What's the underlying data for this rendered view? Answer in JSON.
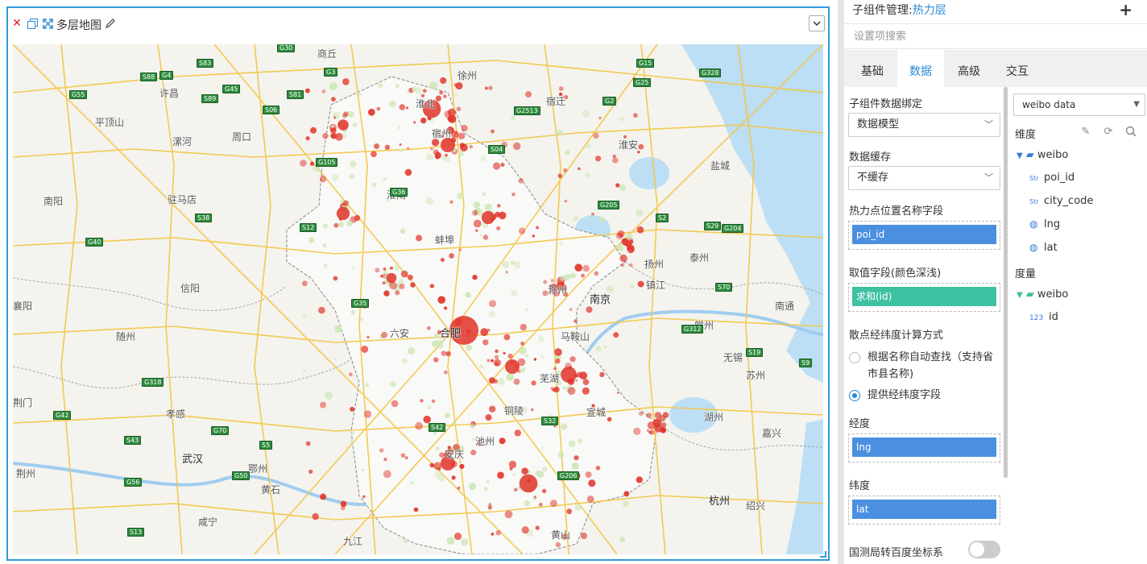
{
  "widget": {
    "title": "多层地图",
    "icons": [
      "close-icon",
      "copy-icon",
      "fullscreen-icon",
      "pencil-icon",
      "chevron-down-icon"
    ]
  },
  "map": {
    "cities": [
      {
        "name": "商丘"
      },
      {
        "name": "徐州"
      },
      {
        "name": "许昌"
      },
      {
        "name": "淮北"
      },
      {
        "name": "宿迁"
      },
      {
        "name": "平顶山"
      },
      {
        "name": "周口"
      },
      {
        "name": "宿州"
      },
      {
        "name": "漯河"
      },
      {
        "name": "淮安"
      },
      {
        "name": "盐城"
      },
      {
        "name": "驻马店"
      },
      {
        "name": "南阳"
      },
      {
        "name": "蚌埠"
      },
      {
        "name": "淮南"
      },
      {
        "name": "扬州"
      },
      {
        "name": "泰州"
      },
      {
        "name": "信阳"
      },
      {
        "name": "滁州"
      },
      {
        "name": "镇江"
      },
      {
        "name": "南京"
      },
      {
        "name": "南通"
      },
      {
        "name": "襄阳"
      },
      {
        "name": "随州"
      },
      {
        "name": "六安"
      },
      {
        "name": "合肥"
      },
      {
        "name": "马鞍山"
      },
      {
        "name": "常州"
      },
      {
        "name": "无锡"
      },
      {
        "name": "苏州"
      },
      {
        "name": "荆门"
      },
      {
        "name": "孝感"
      },
      {
        "name": "铜陵"
      },
      {
        "name": "芜湖"
      },
      {
        "name": "宣城"
      },
      {
        "name": "湖州"
      },
      {
        "name": "嘉兴"
      },
      {
        "name": "武汉"
      },
      {
        "name": "鄂州"
      },
      {
        "name": "池州"
      },
      {
        "name": "荆州"
      },
      {
        "name": "黄石"
      },
      {
        "name": "咸宁"
      },
      {
        "name": "杭州"
      },
      {
        "name": "绍兴"
      },
      {
        "name": "九江"
      },
      {
        "name": "安庆"
      },
      {
        "name": "黄山"
      }
    ],
    "road_shields": [
      "G30",
      "G3",
      "S83",
      "G4",
      "S88",
      "G45",
      "S89",
      "S81",
      "G15",
      "G25",
      "G328",
      "G55",
      "S06",
      "G2513",
      "G2",
      "S04",
      "G105",
      "S38",
      "S12",
      "G36",
      "G205",
      "G40",
      "S29",
      "G204",
      "S70",
      "S19",
      "S9",
      "S32",
      "S42",
      "G50",
      "S5",
      "S13",
      "G70",
      "G318",
      "G312",
      "G35",
      "G42",
      "S43",
      "G206",
      "G56",
      "S2"
    ]
  },
  "side": {
    "header_prefix": "子组件管理:",
    "header_value": "热力层",
    "search_placeholder": "设置项搜索",
    "tabs": [
      "基础",
      "数据",
      "高级",
      "交互"
    ],
    "active_tab": "数据"
  },
  "form": {
    "binding_label": "子组件数据绑定",
    "binding_value": "数据模型",
    "cache_label": "数据缓存",
    "cache_value": "不缓存",
    "name_field_label": "热力点位置名称字段",
    "name_field_value": "poi_id",
    "value_field_label": "取值字段(颜色深浅)",
    "value_field_value": "求和(id)",
    "calc_label": "散点经纬度计算方式",
    "calc_option1": "根据名称自动查找（支持省市县名称)",
    "calc_option2": "提供经纬度字段",
    "calc_selected": 2,
    "lng_label": "经度",
    "lng_value": "lng",
    "lat_label": "纬度",
    "lat_value": "lat",
    "convert_label": "国测局转百度坐标系",
    "convert_on": false
  },
  "fields": {
    "dataset": "weibo data",
    "dim_title": "维度",
    "dim_folder": "weibo",
    "dimensions": [
      {
        "type": "Str",
        "name": "poi_id"
      },
      {
        "type": "Str",
        "name": "city_code"
      },
      {
        "type": "geo",
        "name": "lng"
      },
      {
        "type": "geo",
        "name": "lat"
      }
    ],
    "measure_title": "度量",
    "measure_folder": "weibo",
    "measures": [
      {
        "type": "123",
        "name": "id"
      }
    ]
  },
  "colors": {
    "accent": "#2a8ad6",
    "panel_border": "#2f9bdb",
    "pill_blue": "#4a8fe0",
    "pill_green": "#3ec1a0",
    "heat": "#e0342a",
    "road_shield": "#2e8b3d"
  }
}
